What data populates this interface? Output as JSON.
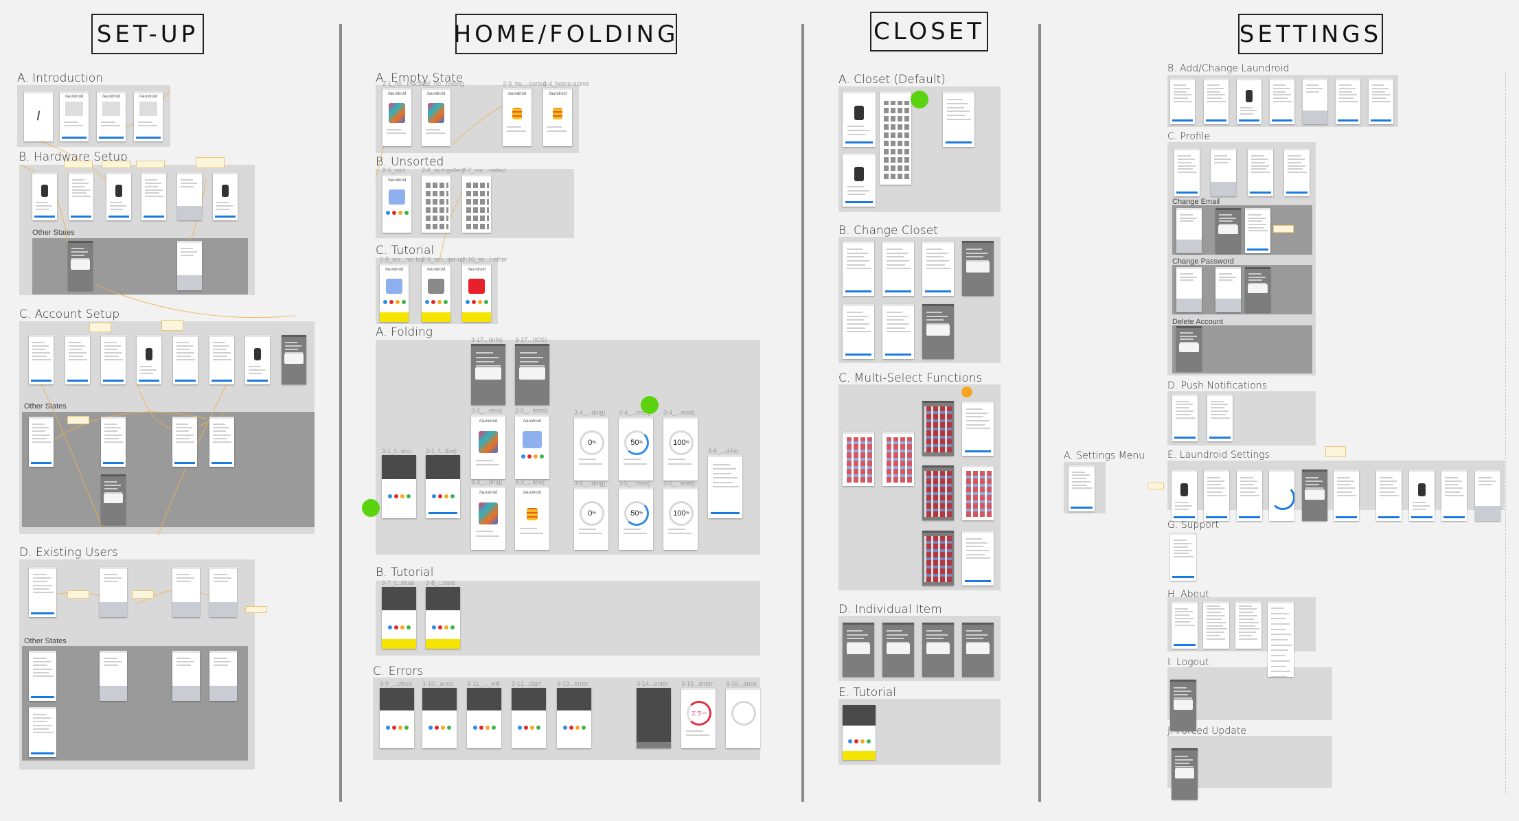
{
  "app_brand": "/laundroid",
  "setup": {
    "title": "SET-UP",
    "introduction": "A. Introduction",
    "hardware": "B. Hardware Setup",
    "hardware_other": "Other States",
    "account": "C. Account Setup",
    "account_other": "Other States",
    "existing": "D. Existing Users",
    "existing_other": "Other States"
  },
  "home": {
    "title": "HOME/FOLDING",
    "empty_state": "A. Empty State",
    "empty_screens": [
      "2-1_ho...inactive",
      "2-2_ho...folding",
      "2-3_ho...-sorted",
      "2-4_home-active"
    ],
    "unsorted": "B. Unsorted",
    "unsorted_screens": [
      "2-5_sort",
      "2-6_sort-gallery",
      "2-7_sor...-select"
    ],
    "tutorial": "C. Tutorial",
    "tutorial_screens": [
      "2-8_sor...rial-tap",
      "2-9_sor...ipe-up",
      "2-10_so...l-other"
    ],
    "folding": "A. Folding",
    "folding_screens": [
      "3-17...(info)",
      "3-17...(iOS)",
      "3-2_...ress)",
      "2-5_...leted)",
      "3-3_...ding)",
      "3-3_...lete)",
      "3-4_...ding)",
      "3-4_...ress)",
      "3-4_...eted)",
      "3-5_...ding)",
      "3-5_...ress)",
      "3-5_...eted)",
      "3-1_f...enu",
      "3-1_f...tive)",
      "3-6_...d-list"
    ],
    "progress": [
      "0",
      "50",
      "100"
    ],
    "progress_unit": "%",
    "folding_tutorial": "B. Tutorial",
    "folding_tutorial_screens": [
      "3-7_t...idual",
      "3-8_...ixed"
    ],
    "errors": "C. Errors",
    "error_screens": [
      "3-9_...othes",
      "3-10...ance",
      "3-11_..._wifi",
      "3-12...start",
      "3-13...enter",
      "3-14...enter",
      "3-15...enter",
      "3-16...ance"
    ],
    "error_ring_text": "エラー"
  },
  "closet": {
    "title": "CLOSET",
    "default": "A. Closet (Default)",
    "change": "B. Change Closet",
    "multi_select": "C. Multi-Select Functions",
    "individual": "D. Individual Item",
    "tutorial": "E. Tutorial"
  },
  "settings": {
    "title": "SETTINGS",
    "menu": "A. Settings Menu",
    "add_change": "B. Add/Change Laundroid",
    "profile": "C. Profile",
    "change_email": "Change Email",
    "change_password": "Change Password",
    "delete_account": "Delete Account",
    "push": "D. Push Notifications",
    "laundroid_settings": "E. Laundroid Settings",
    "support": "G. Support",
    "about": "H. About",
    "logout": "I. Logout",
    "forced_update": "J. Forced Update"
  },
  "colors": {
    "background": "#f2f2f2",
    "panel": "#d9d9d9",
    "panel_dark": "#9a9a9a",
    "accent_blue": "#1a7ae0",
    "highlight_yellow": "#f5e400",
    "marker_green": "#5bd40f",
    "marker_orange": "#f5a623",
    "connector": "#f0b24a"
  }
}
